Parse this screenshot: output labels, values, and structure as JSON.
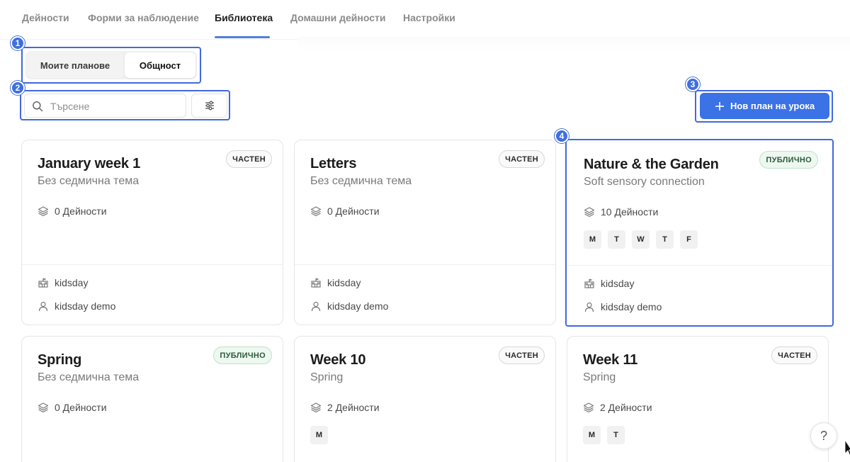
{
  "nav": {
    "tabs": [
      {
        "label": "Дейности",
        "active": false
      },
      {
        "label": "Форми за наблюдение",
        "active": false
      },
      {
        "label": "Библиотека",
        "active": true
      },
      {
        "label": "Домашни дейности",
        "active": false
      },
      {
        "label": "Настройки",
        "active": false
      }
    ]
  },
  "switcher": {
    "my_plans": "Моите планове",
    "community": "Общност",
    "selected": "community"
  },
  "search": {
    "placeholder": "Търсене"
  },
  "actions": {
    "new_plan_label": "Нов план на урока"
  },
  "markers": [
    "1",
    "2",
    "3",
    "4"
  ],
  "cards": [
    {
      "title": "January week 1",
      "subtitle": "Без седмична тема",
      "badge": "ЧАСТЕН",
      "visibility": "private",
      "count_label": "0 Дейности",
      "days": [],
      "org": "kidsday",
      "user": "kidsday demo"
    },
    {
      "title": "Letters",
      "subtitle": "Без седмична тема",
      "badge": "ЧАСТЕН",
      "visibility": "private",
      "count_label": "0 Дейности",
      "days": [],
      "org": "kidsday",
      "user": "kidsday demo"
    },
    {
      "title": "Nature & the Garden",
      "subtitle": "Soft sensory connection",
      "badge": "ПУБЛИЧНО",
      "visibility": "public",
      "count_label": "10 Дейности",
      "days": [
        "M",
        "T",
        "W",
        "T",
        "F"
      ],
      "org": "kidsday",
      "user": "kidsday demo"
    },
    {
      "title": "Spring",
      "subtitle": "Без седмична тема",
      "badge": "ПУБЛИЧНО",
      "visibility": "public",
      "count_label": "0 Дейности",
      "days": [],
      "org": "",
      "user": ""
    },
    {
      "title": "Week 10",
      "subtitle": "Spring",
      "badge": "ЧАСТЕН",
      "visibility": "private",
      "count_label": "2 Дейности",
      "days": [
        "M"
      ],
      "org": "",
      "user": ""
    },
    {
      "title": "Week 11",
      "subtitle": "Spring",
      "badge": "ЧАСТЕН",
      "visibility": "private",
      "count_label": "2 Дейности",
      "days": [
        "M",
        "T"
      ],
      "org": "",
      "user": ""
    }
  ],
  "help": {
    "label": "?"
  },
  "colors": {
    "accent": "#3b73e6",
    "annotation": "#4169e1",
    "public_badge": "#edf8f0"
  }
}
